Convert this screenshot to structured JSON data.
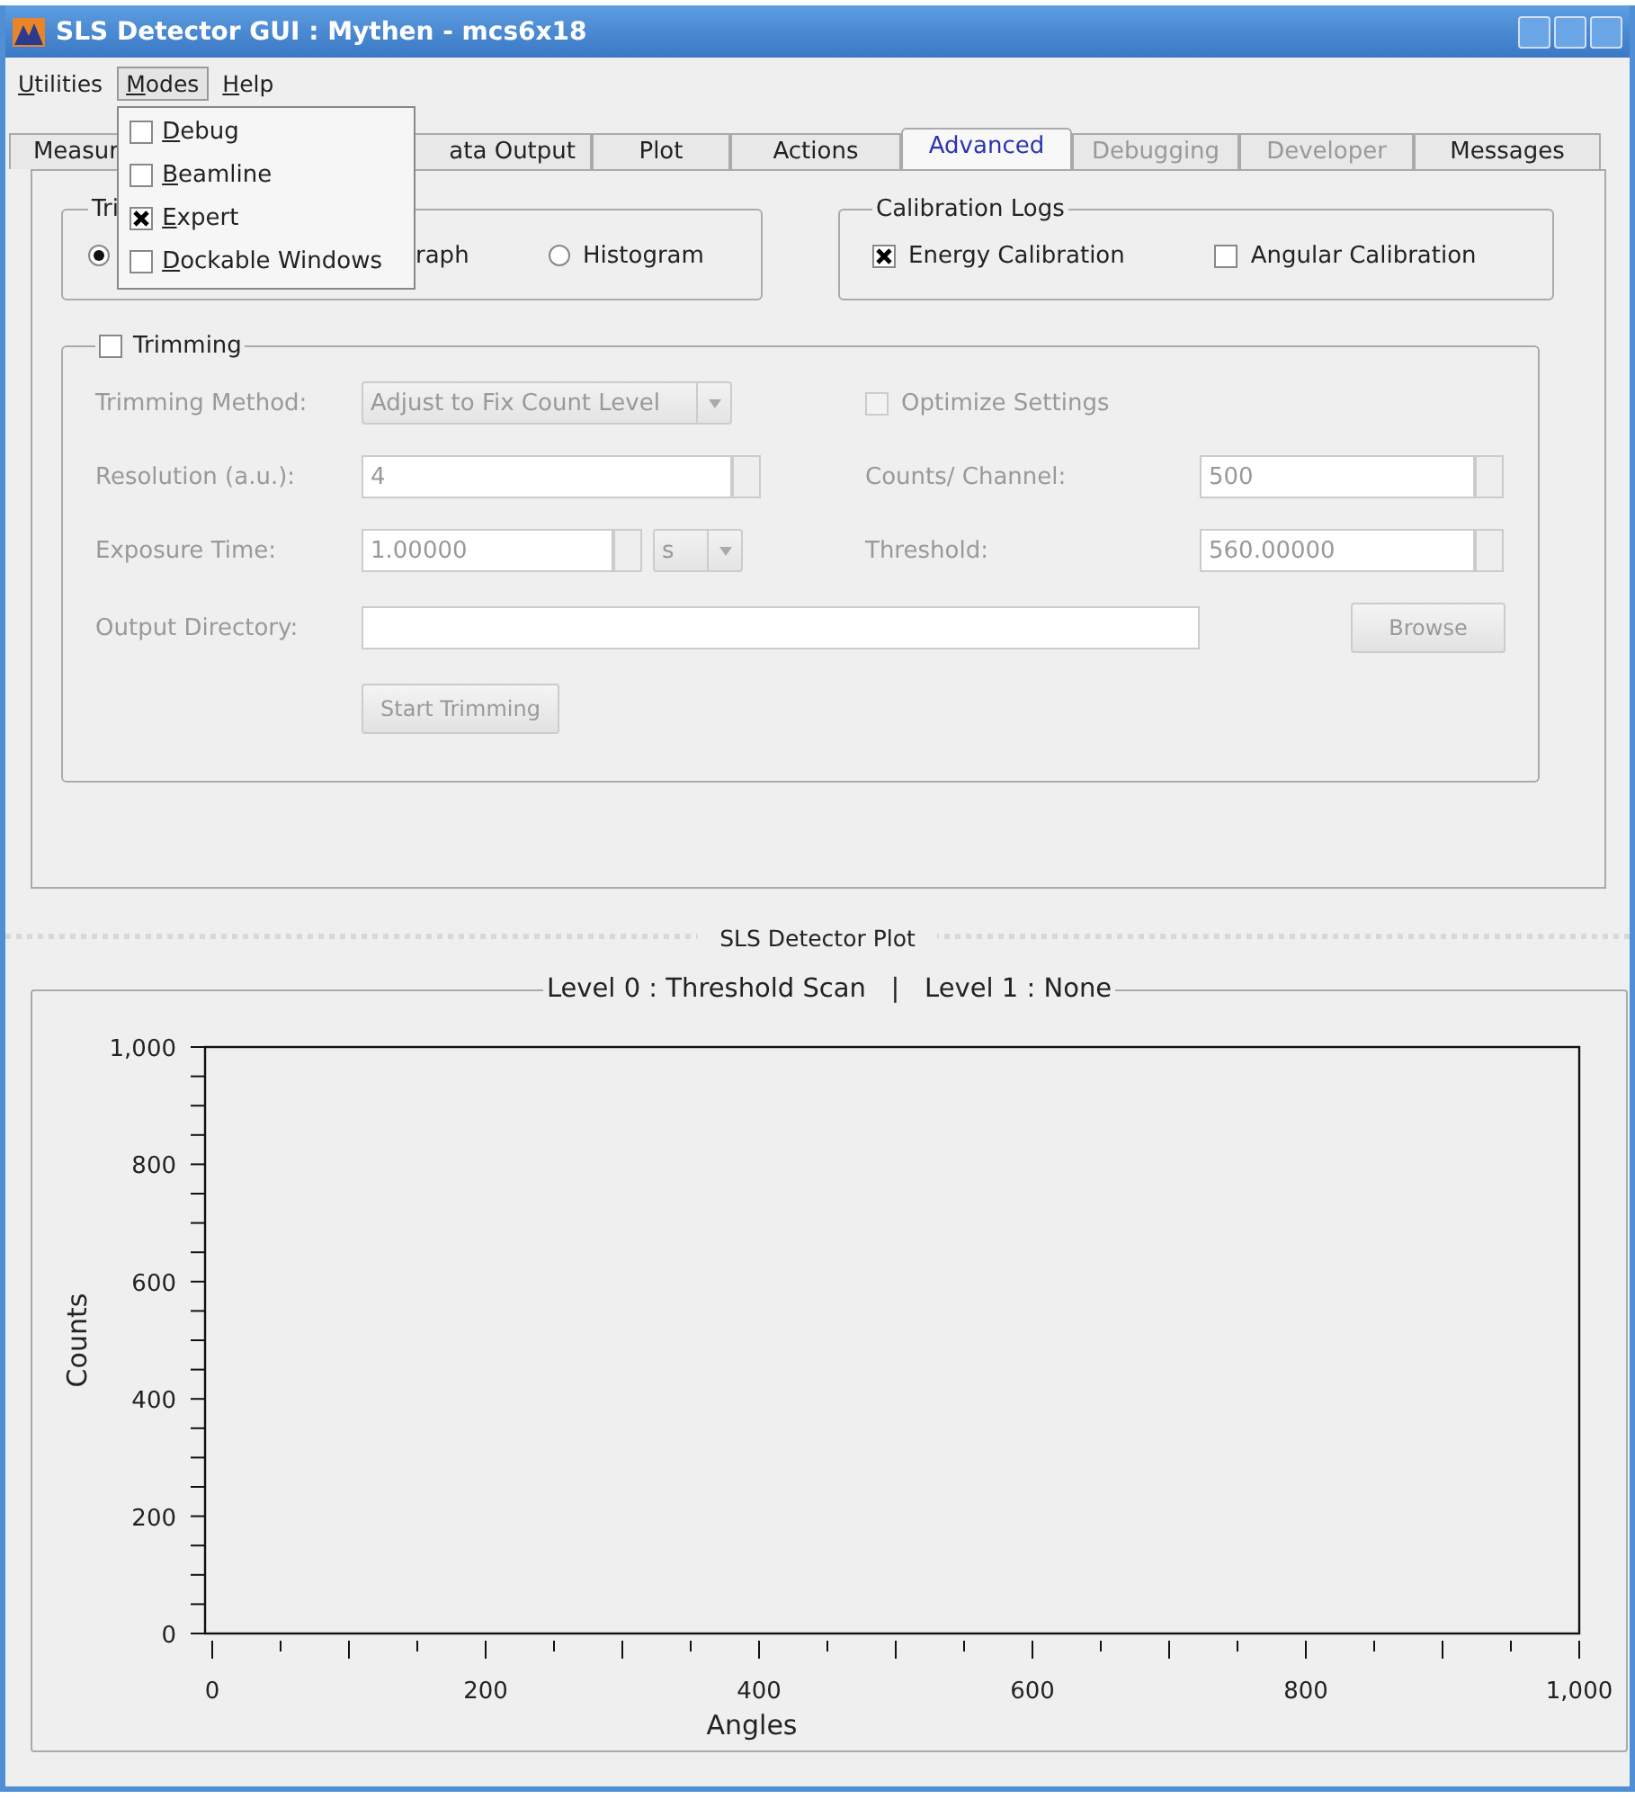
{
  "window": {
    "title": "SLS Detector GUI : Mythen - mcs6x18"
  },
  "menu_bar": [
    {
      "label": "Utilities",
      "selected": false
    },
    {
      "label": "Modes",
      "selected": true
    },
    {
      "label": "Help",
      "selected": false
    }
  ],
  "open_menu": {
    "items": [
      {
        "label": "Debug",
        "checked": false
      },
      {
        "label": "Beamline",
        "checked": false
      },
      {
        "label": "Expert",
        "checked": true
      },
      {
        "label": "Dockable Windows",
        "checked": false
      }
    ]
  },
  "tabs": [
    {
      "label": "Measur",
      "selected": false,
      "disabled": false
    },
    {
      "label": "ata Output",
      "selected": false,
      "disabled": false
    },
    {
      "label": "Plot",
      "selected": false,
      "disabled": false
    },
    {
      "label": "Actions",
      "selected": false,
      "disabled": false
    },
    {
      "label": "Advanced",
      "selected": true,
      "disabled": false
    },
    {
      "label": "Debugging",
      "selected": false,
      "disabled": true
    },
    {
      "label": "Developer",
      "selected": false,
      "disabled": true
    },
    {
      "label": "Messages",
      "selected": false,
      "disabled": false
    }
  ],
  "plot_type_group": {
    "title": "Tri",
    "options": [
      {
        "selected": true
      },
      {
        "label": "raph"
      },
      {
        "label": "Histogram",
        "selected": false
      }
    ]
  },
  "calibration_logs": {
    "title": "Calibration Logs",
    "options": [
      {
        "label": "Energy Calibration",
        "checked": true
      },
      {
        "label": "Angular Calibration",
        "checked": false
      }
    ]
  },
  "trimming": {
    "title": "Trimming",
    "checked": false,
    "disabled": true,
    "method": {
      "label": "Trimming Method:",
      "value": "Adjust to Fix Count Level"
    },
    "optimize": {
      "label": "Optimize Settings",
      "checked": false
    },
    "resolution": {
      "label": "Resolution (a.u.):",
      "value": "4"
    },
    "counts": {
      "label": "Counts/ Channel:",
      "value": "500"
    },
    "exposure": {
      "label": "Exposure Time:",
      "value": "1.00000",
      "unit": "s"
    },
    "threshold": {
      "label": "Threshold:",
      "value": "560.00000"
    },
    "output_directory": {
      "label": "Output Directory:"
    },
    "browse": "Browse",
    "start": "Start Trimming"
  },
  "plot_dock": {
    "title": "SLS Detector Plot"
  },
  "plot": {
    "title": "Level 0 : Threshold Scan   |   Level 1 : None",
    "chart_data": {
      "type": "line",
      "xlabel": "Angles",
      "ylabel": "Counts",
      "xlim": [
        0,
        1000
      ],
      "ylim": [
        0,
        1000
      ],
      "xticks": [
        0,
        200,
        400,
        600,
        800,
        {
          "value": 1000,
          "label": "1,000"
        }
      ],
      "yticks": [
        0,
        200,
        400,
        600,
        800,
        {
          "value": 1000,
          "label": "1,000"
        }
      ]
    }
  }
}
